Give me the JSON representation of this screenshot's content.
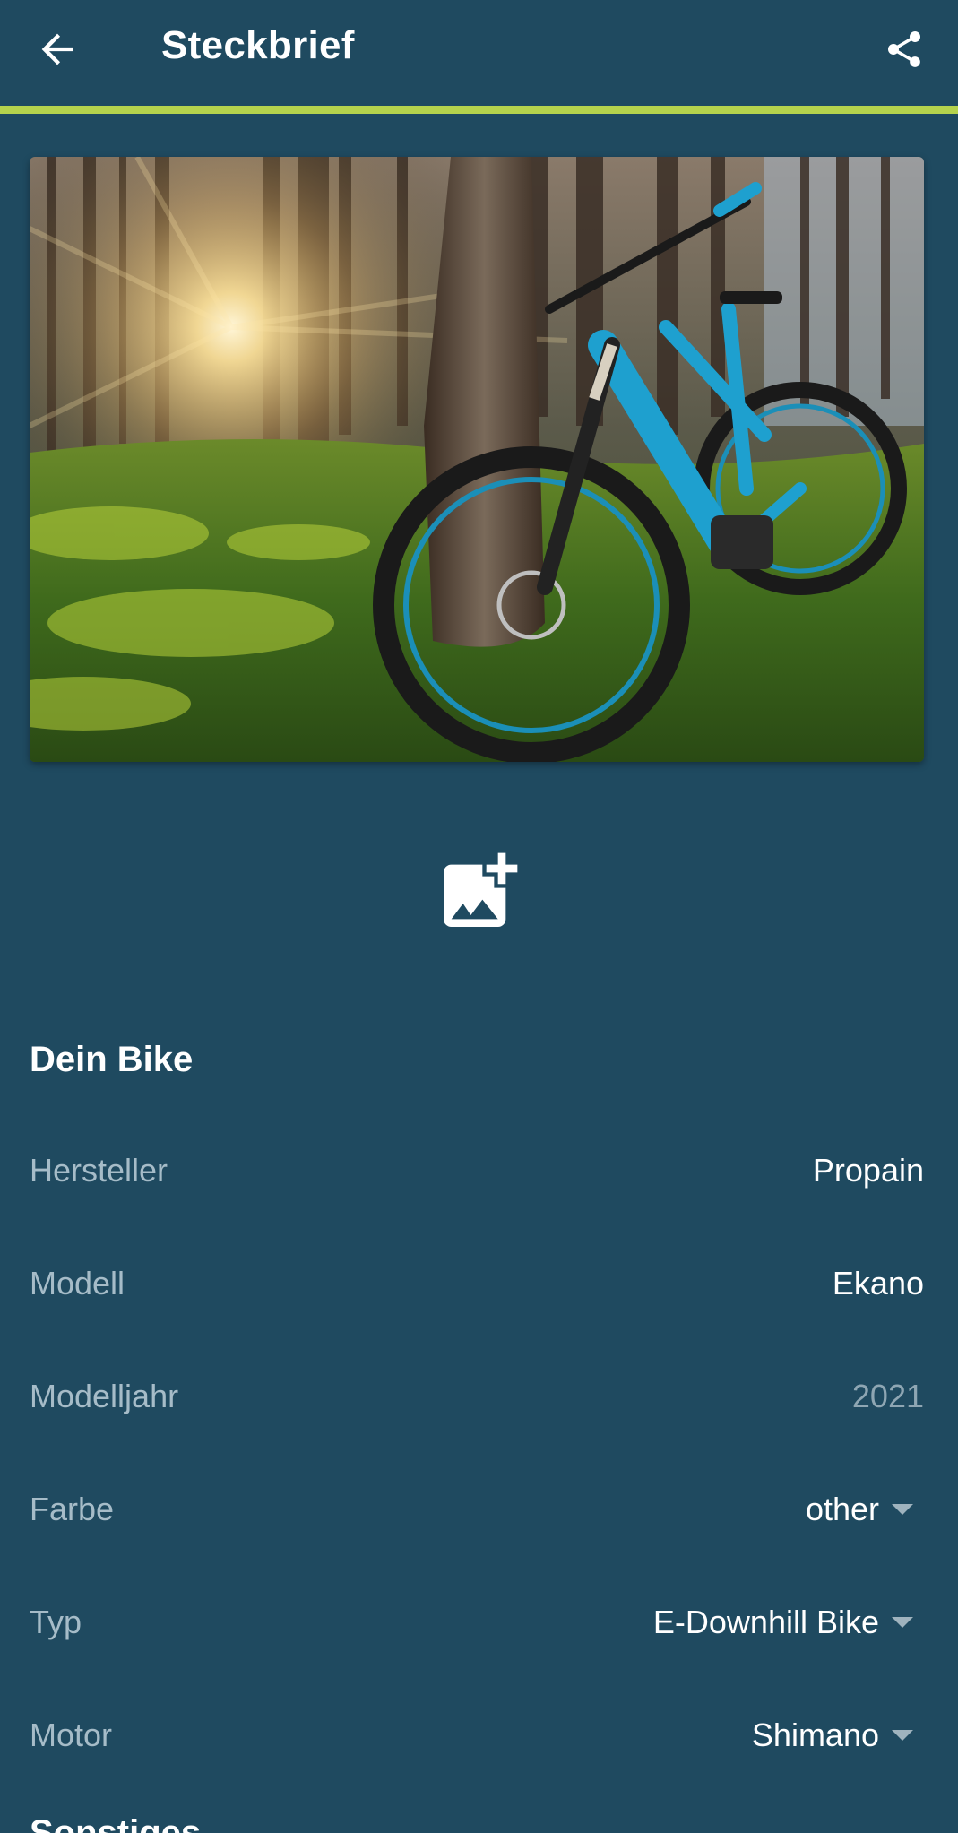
{
  "appbar": {
    "title": "Steckbrief",
    "back_icon": "arrow-back-icon",
    "share_icon": "share-icon",
    "accent_color": "#b5d34d",
    "background_color": "#1f4a60"
  },
  "photo": {
    "icon": "bike-photo"
  },
  "add_photo": {
    "icon": "add-photo-icon"
  },
  "bike_section": {
    "title": "Dein Bike",
    "rows": [
      {
        "label": "Hersteller",
        "value": "Propain"
      },
      {
        "label": "Modell",
        "value": "Ekano"
      },
      {
        "label": "Modelljahr",
        "value": "2021"
      },
      {
        "label": "Farbe",
        "value": "other"
      },
      {
        "label": "Typ",
        "value": "E-Downhill Bike"
      },
      {
        "label": "Motor",
        "value": "Shimano"
      }
    ]
  },
  "next_section": {
    "title": "Sonstiges"
  }
}
